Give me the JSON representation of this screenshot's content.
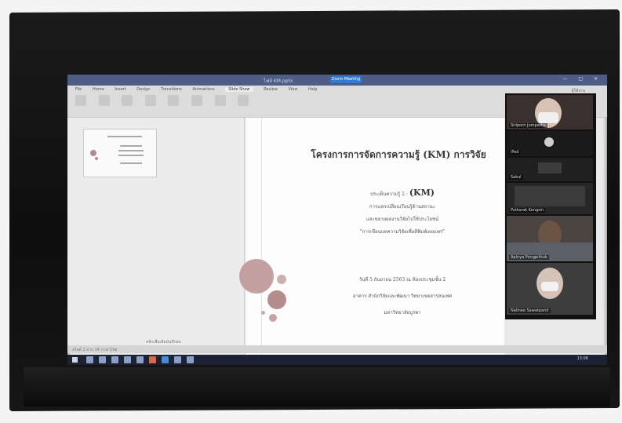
{
  "window": {
    "doc_title": "ไฟล์ KM.pptx",
    "meeting_label": "Zoom Meeting",
    "window_controls": "— □ ✕"
  },
  "ribbon": {
    "tabs": [
      "File",
      "Home",
      "Insert",
      "Design",
      "Transitions",
      "Animations",
      "Slide Show",
      "Review",
      "View",
      "Help"
    ],
    "active_tab": "Slide Show",
    "account": "ผู้ใช้งาน"
  },
  "thumbnail": {
    "notes_label": "คลิกเพื่อเพิ่มบันทึกย่อ"
  },
  "slide": {
    "title": "โครงการการจัดการความรู้ (KM) การวิจัย",
    "subtitle_prefix": "ประเด็นความรู้ 2 :",
    "subtitle_km": "(KM)",
    "body_lines": [
      "การแลกเปลี่ยนเรียนรู้ด้านสถานะ",
      "และขยายผลงานวิจัยไปใช้ประโยชน์",
      "\"การเขียนบทความวิจัยเพื่อตีพิมพ์เผยแพร่\""
    ],
    "footer_lines": [
      "วันที่ 5 กันยายน 2563 ณ ห้องประชุมชั้น 2",
      "อาคาร สำนักวิจัยและพัฒนา วิทยาเขตสารสนเทศ",
      "มหาวิทยาลัยบูรพา"
    ],
    "circle_color": "#c39a9a"
  },
  "participants": [
    {
      "name": "Siriporn Jumpatha"
    },
    {
      "name": "iPad"
    },
    {
      "name": "Sakul"
    },
    {
      "name": "Puttarak Kongsin"
    },
    {
      "name": "Apinya Pongpithuk"
    },
    {
      "name": "Nalinee Sawatpanit"
    }
  ],
  "statusbar": {
    "left": "สไลด์ 1 จาก 14  ภาษาไทย"
  },
  "taskbar": {
    "clock": "13:06"
  }
}
